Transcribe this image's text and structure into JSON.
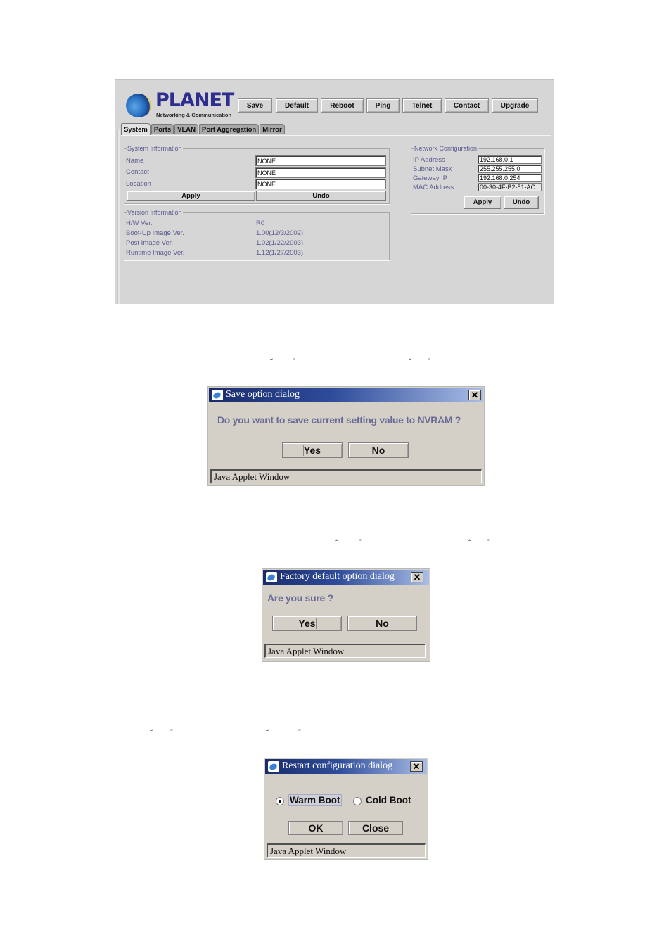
{
  "applet": {
    "logo": {
      "brand": "PLANET",
      "tagline": "Networking & Communication"
    },
    "toolbar": [
      {
        "label": "Save"
      },
      {
        "label": "Default"
      },
      {
        "label": "Reboot"
      },
      {
        "label": "Ping"
      },
      {
        "label": "Telnet"
      },
      {
        "label": "Contact"
      },
      {
        "label": "Upgrade"
      }
    ],
    "tabs": [
      {
        "label": "System",
        "active": true
      },
      {
        "label": "Ports"
      },
      {
        "label": "VLAN"
      },
      {
        "label": "Port Aggregation"
      },
      {
        "label": "Mirror"
      }
    ],
    "system_information": {
      "legend": "System Information",
      "fields": [
        {
          "label": "Name",
          "value": "NONE"
        },
        {
          "label": "Contact",
          "value": "NONE"
        },
        {
          "label": "Location",
          "value": "NONE"
        }
      ],
      "apply_label": "Apply",
      "undo_label": "Undo"
    },
    "version_information": {
      "legend": "Version Information",
      "rows": [
        {
          "label": "H/W Ver.",
          "value": "R0"
        },
        {
          "label": "Boot-Up Image Ver.",
          "value": "1.00(12/3/2002)"
        },
        {
          "label": "Post Image Ver.",
          "value": "1.02(1/22/2003)"
        },
        {
          "label": "Runtime Image Ver.",
          "value": "1.12(1/27/2003)"
        }
      ]
    },
    "network_configuration": {
      "legend": "Network Configuration",
      "fields": [
        {
          "label": "IP Address",
          "value": "192.168.0.1"
        },
        {
          "label": "Subnet Mask",
          "value": "255.255.255.0"
        },
        {
          "label": "Gateway IP",
          "value": "192.168.0.254"
        },
        {
          "label": "MAC Address",
          "value": "00-30-4F-B2-51-AC"
        }
      ],
      "apply_label": "Apply",
      "undo_label": "Undo"
    }
  },
  "quotes": {
    "open": "“",
    "close": "”"
  },
  "dialogs": {
    "save": {
      "title": "Save option dialog",
      "message": "Do you want to save current setting value to NVRAM ?",
      "yes_label": "Yes",
      "no_label": "No",
      "status": "Java Applet Window"
    },
    "factory_default": {
      "title": "Factory default option dialog",
      "message": "Are you sure ?",
      "yes_label": "Yes",
      "no_label": "No",
      "status": "Java Applet Window"
    },
    "restart": {
      "title": "Restart configuration dialog",
      "options": [
        {
          "label": "Warm Boot",
          "selected": true
        },
        {
          "label": "Cold Boot",
          "selected": false
        }
      ],
      "ok_label": "OK",
      "close_label": "Close",
      "status": "Java Applet Window"
    }
  }
}
